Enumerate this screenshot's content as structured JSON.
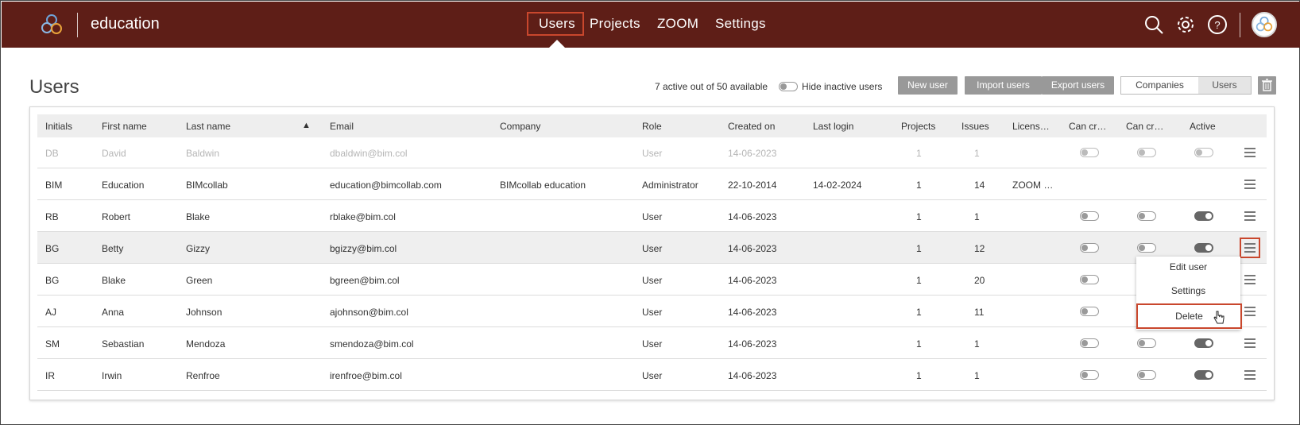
{
  "topbar": {
    "brand": "education",
    "nav": [
      "Users",
      "Projects",
      "ZOOM",
      "Settings"
    ],
    "icons": [
      "logo-icon",
      "search-icon",
      "gear-icon",
      "help-icon",
      "avatar"
    ]
  },
  "header": {
    "title": "Users",
    "active_count": "7 active out of 50 available",
    "hide_inactive_label": "Hide inactive users",
    "buttons": {
      "new": "New user",
      "import": "Import users",
      "export": "Export users"
    },
    "segment": {
      "companies": "Companies",
      "users": "Users",
      "selected": "Users"
    }
  },
  "table": {
    "columns": [
      "Initials",
      "First name",
      "Last name",
      "Email",
      "Company",
      "Role",
      "Created on",
      "Last login",
      "Projects",
      "Issues",
      "Licens…",
      "Can cr…",
      "Can cr…",
      "Active"
    ],
    "sorted_by": "Last name",
    "sort_icon": "▲",
    "rows": [
      {
        "initials": "DB",
        "first": "David",
        "last": "Baldwin",
        "email": "dbaldwin@bim.col",
        "company": "",
        "role": "User",
        "created": "14-06-2023",
        "last_login": "",
        "projects": "1",
        "issues": "1",
        "license": "",
        "can1": false,
        "can2": false,
        "active": false,
        "inactive": true
      },
      {
        "initials": "BIM",
        "first": "Education",
        "last": "BIMcollab",
        "email": "education@bimcollab.com",
        "company": "BIMcollab education",
        "role": "Administrator",
        "created": "22-10-2014",
        "last_login": "14-02-2024",
        "projects": "1",
        "issues": "14",
        "license": "ZOOM …",
        "can1": null,
        "can2": null,
        "active": null,
        "inactive": false
      },
      {
        "initials": "RB",
        "first": "Robert",
        "last": "Blake",
        "email": "rblake@bim.col",
        "company": "",
        "role": "User",
        "created": "14-06-2023",
        "last_login": "",
        "projects": "1",
        "issues": "1",
        "license": "",
        "can1": false,
        "can2": false,
        "active": true,
        "inactive": false
      },
      {
        "initials": "BG",
        "first": "Betty",
        "last": "Gizzy",
        "email": "bgizzy@bim.col",
        "company": "",
        "role": "User",
        "created": "14-06-2023",
        "last_login": "",
        "projects": "1",
        "issues": "12",
        "license": "",
        "can1": false,
        "can2": false,
        "active": true,
        "inactive": false
      },
      {
        "initials": "BG",
        "first": "Blake",
        "last": "Green",
        "email": "bgreen@bim.col",
        "company": "",
        "role": "User",
        "created": "14-06-2023",
        "last_login": "",
        "projects": "1",
        "issues": "20",
        "license": "",
        "can1": false,
        "can2": null,
        "active": null,
        "inactive": false
      },
      {
        "initials": "AJ",
        "first": "Anna",
        "last": "Johnson",
        "email": "ajohnson@bim.col",
        "company": "",
        "role": "User",
        "created": "14-06-2023",
        "last_login": "",
        "projects": "1",
        "issues": "11",
        "license": "",
        "can1": false,
        "can2": null,
        "active": null,
        "inactive": false
      },
      {
        "initials": "SM",
        "first": "Sebastian",
        "last": "Mendoza",
        "email": "smendoza@bim.col",
        "company": "",
        "role": "User",
        "created": "14-06-2023",
        "last_login": "",
        "projects": "1",
        "issues": "1",
        "license": "",
        "can1": false,
        "can2": false,
        "active": true,
        "inactive": false
      },
      {
        "initials": "IR",
        "first": "Irwin",
        "last": "Renfroe",
        "email": "irenfroe@bim.col",
        "company": "",
        "role": "User",
        "created": "14-06-2023",
        "last_login": "",
        "projects": "1",
        "issues": "1",
        "license": "",
        "can1": false,
        "can2": false,
        "active": true,
        "inactive": false
      }
    ]
  },
  "row_menu": {
    "items": [
      "Edit user",
      "Settings",
      "Delete"
    ],
    "highlighted": "Delete"
  },
  "colors": {
    "topbar": "#5e1e17",
    "highlight": "#c9472d",
    "button": "#999999"
  }
}
